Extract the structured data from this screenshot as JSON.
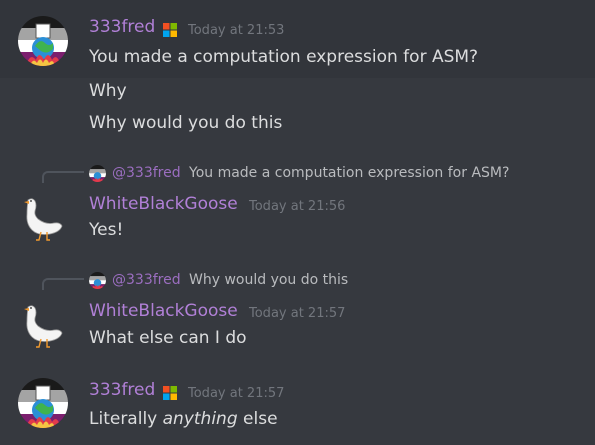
{
  "messages": [
    {
      "author": "333fred",
      "timestamp": "Today at 21:53",
      "lines": [
        "You made a computation expression for ASM?",
        "Why",
        "Why would you do this"
      ]
    },
    {
      "reply_to": {
        "mention": "@333fred",
        "text": "You made a computation expression for ASM?"
      },
      "author": "WhiteBlackGoose",
      "timestamp": "Today at 21:56",
      "lines": [
        "Yes!"
      ]
    },
    {
      "reply_to": {
        "mention": "@333fred",
        "text": "Why would you do this"
      },
      "author": "WhiteBlackGoose",
      "timestamp": "Today at 21:57",
      "lines": [
        "What else can I do"
      ]
    },
    {
      "author": "333fred",
      "timestamp": "Today at 21:57",
      "lines_rich": {
        "prefix": "Literally ",
        "emphasis": "anything",
        "suffix": " else"
      }
    }
  ],
  "colors": {
    "background": "#36393f",
    "author": "#b180d7",
    "timestamp": "#72767d",
    "text": "#dcddde",
    "reply_text": "#b9bbbe"
  },
  "icons": {
    "badge": "windows-logo-icon",
    "avatar_fred": "flag-globe-avatar",
    "avatar_goose": "goose-avatar"
  }
}
